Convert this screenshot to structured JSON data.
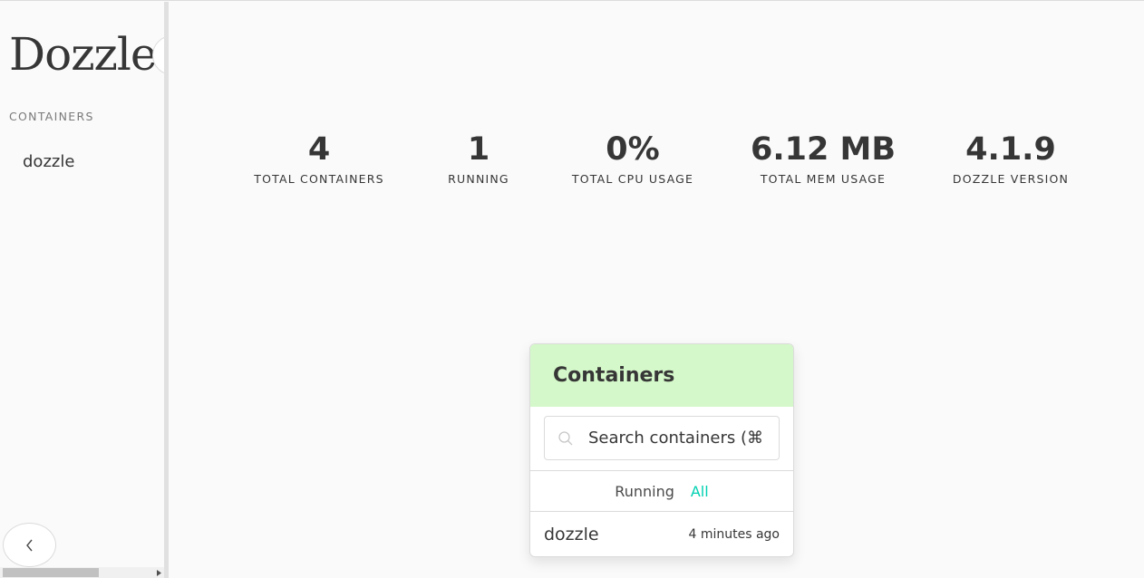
{
  "sidebar": {
    "logo": "Dozzle",
    "menu_label": "CONTAINERS",
    "items": [
      {
        "label": "dozzle"
      }
    ],
    "collapse_icon": "chevron-left-icon"
  },
  "stats": [
    {
      "value": "4",
      "label": "TOTAL CONTAINERS"
    },
    {
      "value": "1",
      "label": "RUNNING"
    },
    {
      "value": "0%",
      "label": "TOTAL CPU USAGE"
    },
    {
      "value": "6.12 MB",
      "label": "TOTAL MEM USAGE"
    },
    {
      "value": "4.1.9",
      "label": "DOZZLE VERSION"
    }
  ],
  "panel": {
    "title": "Containers",
    "search_placeholder": "Search containers (⌘",
    "tabs": [
      {
        "label": "Running",
        "active": false
      },
      {
        "label": "All",
        "active": true
      }
    ],
    "rows": [
      {
        "name": "dozzle",
        "time": "4 minutes ago"
      }
    ]
  },
  "colors": {
    "accent": "#00d1b2",
    "panel_heading_bg": "#d4f8c9",
    "text": "#363636"
  }
}
